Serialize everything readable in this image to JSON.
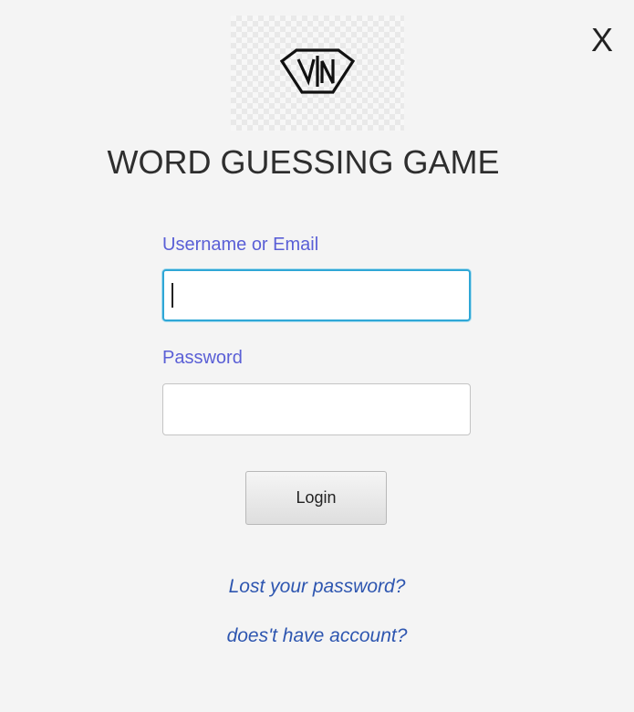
{
  "window": {
    "close_label": "X"
  },
  "logo": {
    "icon": "shield-logo-icon"
  },
  "app": {
    "title": "WORD GUESSING GAME"
  },
  "login_form": {
    "username_label": "Username or Email",
    "username_value": "",
    "password_label": "Password",
    "password_value": "",
    "login_button": "Login"
  },
  "links": {
    "lost_password": "Lost your password?",
    "no_account": "does't have account?"
  },
  "colors": {
    "label": "#5a5fd6",
    "link": "#2e56b0",
    "focus_border": "#2fa7d6",
    "background": "#f4f4f4"
  }
}
